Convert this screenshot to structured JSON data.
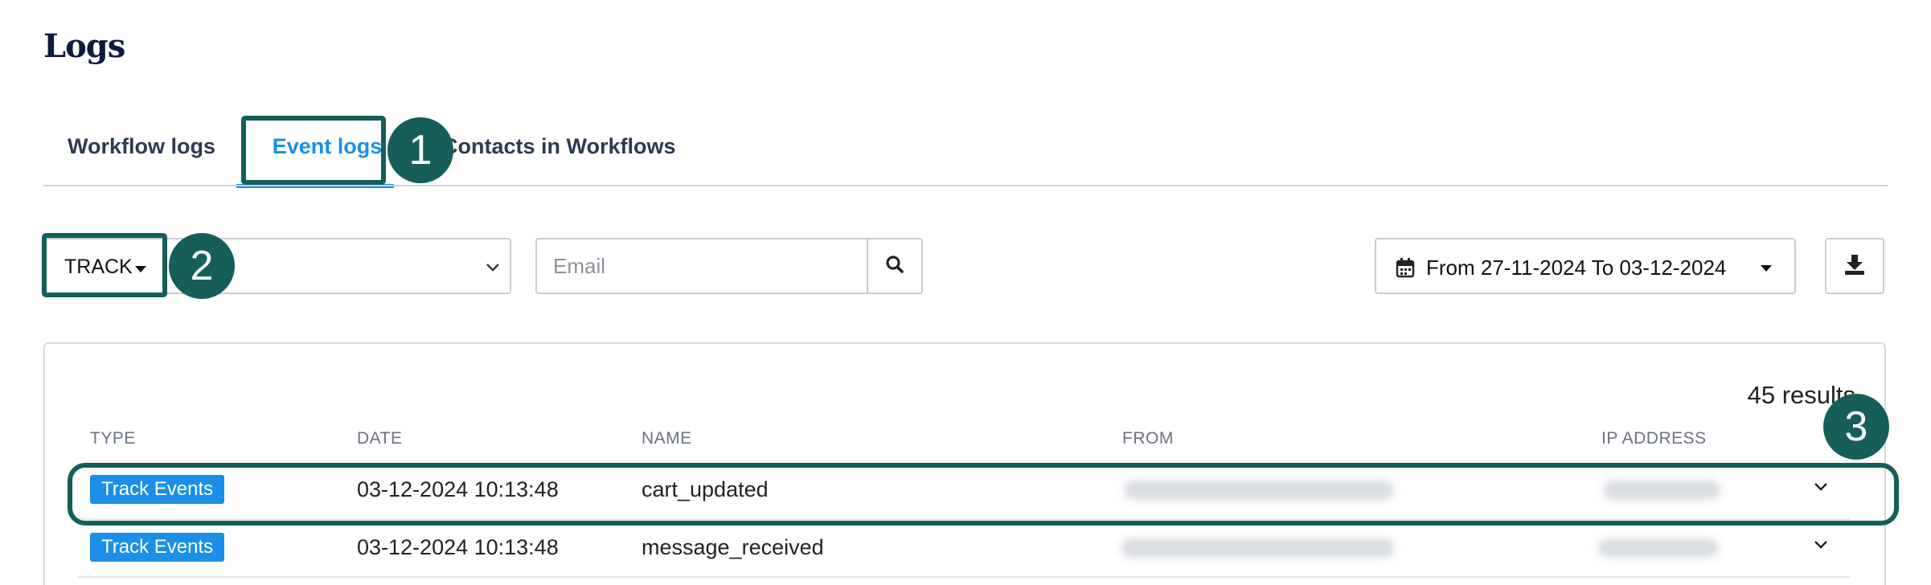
{
  "page": {
    "title": "Logs"
  },
  "tabs": [
    {
      "label": "Workflow logs",
      "active": false
    },
    {
      "label": "Event logs",
      "active": true
    },
    {
      "label": "Contacts in Workflows",
      "active": false
    }
  ],
  "filters": {
    "event_type": "TRACK",
    "email_placeholder": "Email",
    "date_range": "From 27-11-2024 To 03-12-2024"
  },
  "results": {
    "count_label": "45 results",
    "columns": [
      "TYPE",
      "DATE",
      "NAME",
      "FROM",
      "IP ADDRESS"
    ],
    "rows": [
      {
        "type": "Track Events",
        "date": "03-12-2024 10:13:48",
        "name": "cart_updated"
      },
      {
        "type": "Track Events",
        "date": "03-12-2024 10:13:48",
        "name": "message_received"
      }
    ]
  },
  "annotations": {
    "marker1": "1",
    "marker2": "2",
    "marker3": "3"
  },
  "colors": {
    "accent_blue": "#1b8fe8",
    "highlight_teal": "#155e5a",
    "title_navy": "#0e1b3d"
  }
}
